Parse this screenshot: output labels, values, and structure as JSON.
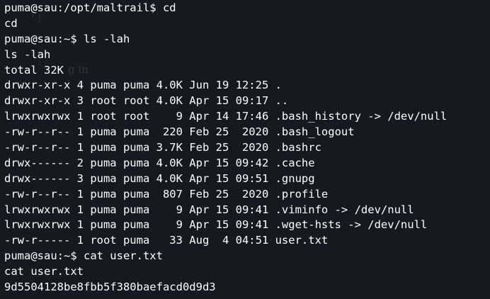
{
  "terminal": {
    "lines": [
      "puma@sau:/opt/maltrail$ cd",
      "cd",
      "puma@sau:~$ ls -lah",
      "ls -lah",
      "total 32K",
      "drwxr-xr-x 4 puma puma 4.0K Jun 19 12:25 .",
      "drwxr-xr-x 3 root root 4.0K Apr 15 09:17 ..",
      "lrwxrwxrwx 1 root root    9 Apr 14 17:46 .bash_history -> /dev/null",
      "-rw-r--r-- 1 puma puma  220 Feb 25  2020 .bash_logout",
      "-rw-r--r-- 1 puma puma 3.7K Feb 25  2020 .bashrc",
      "drwx------ 2 puma puma 4.0K Apr 15 09:42 .cache",
      "drwx------ 3 puma puma 4.0K Apr 15 09:51 .gnupg",
      "-rw-r--r-- 1 puma puma  807 Feb 25  2020 .profile",
      "lrwxrwxrwx 1 puma puma    9 Apr 15 09:41 .viminfo -> /dev/null",
      "lrwxrwxrwx 1 puma puma    9 Apr 15 09:41 .wget-hsts -> /dev/null",
      "-rw-r----- 1 root puma   33 Aug  4 04:51 user.txt",
      "puma@sau:~$ cat user.txt",
      "cat user.txt",
      "9d5504128be8fbb5f380baefacd0d9d3"
    ],
    "ghost_text": [
      "' !",
      "g in"
    ]
  }
}
